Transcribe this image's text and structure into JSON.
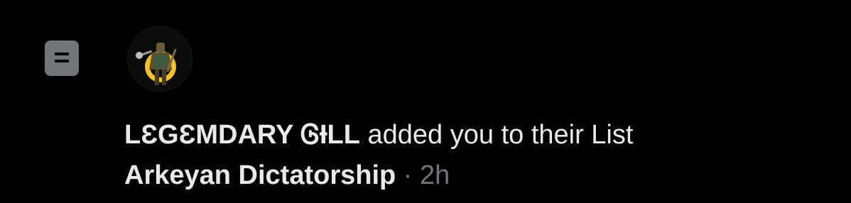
{
  "notification": {
    "icon": "list-icon",
    "user_name": "LƐGƐMDARY ᎶƗLL",
    "action_text": "added you to their List",
    "list_name": "Arkeyan Dictatorship",
    "separator": "·",
    "time": "2h"
  },
  "colors": {
    "background": "#000000",
    "primary_text": "#e7e9ea",
    "secondary_text": "#71767b",
    "icon_bg": "#71767b"
  }
}
